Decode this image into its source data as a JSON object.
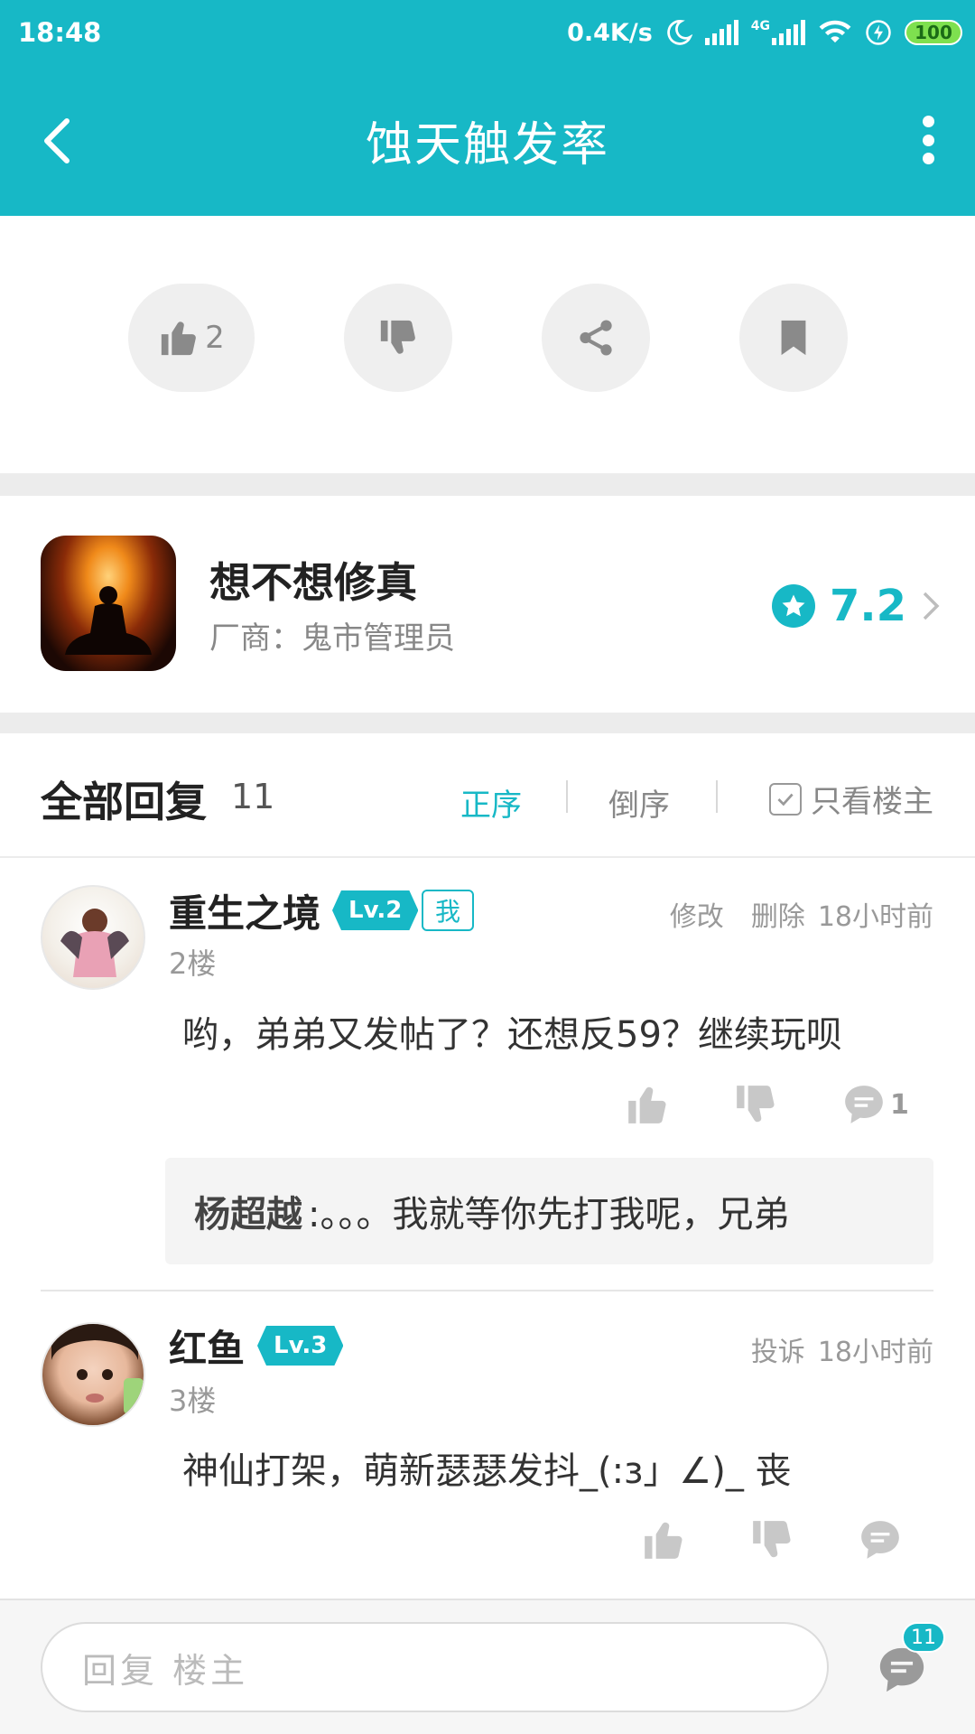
{
  "status_bar": {
    "time": "18:48",
    "net_speed": "0.4K/s",
    "network_type": "4G",
    "battery": "100",
    "icons": [
      "moon-icon",
      "signal-icon",
      "wifi-icon",
      "charging-icon"
    ]
  },
  "header": {
    "title": "蚀天触发率",
    "back_icon": "back-chevron-icon",
    "more_icon": "more-vertical-icon",
    "background": "#17b8c6"
  },
  "actions": {
    "like_count": "2",
    "items": [
      "like-icon",
      "dislike-icon",
      "share-icon",
      "bookmark-icon"
    ]
  },
  "game": {
    "name": "想不想修真",
    "vendor": "厂商：鬼市管理员",
    "rating": "7.2"
  },
  "replies": {
    "title": "全部回复",
    "count": "11",
    "sort_asc": "正序",
    "sort_desc": "倒序",
    "only_owner": "只看楼主",
    "accent": "#17b8c6"
  },
  "comments": [
    {
      "username": "重生之境",
      "level": "Lv.2",
      "me_badge": "我",
      "floor": "2楼",
      "actions": [
        "修改",
        "删除"
      ],
      "time": "18小时前",
      "text": "哟，弟弟又发帖了？还想反59？继续玩呗",
      "reply_count": "1",
      "subreply": {
        "author": "杨超越",
        "text": ":。。。我就等你先打我呢，兄弟"
      }
    },
    {
      "username": "红鱼",
      "level": "Lv.3",
      "floor": "3楼",
      "actions": [
        "投诉"
      ],
      "time": "18小时前",
      "text": "神仙打架，萌新瑟瑟发抖_(:з」∠)_ 丧"
    }
  ],
  "bottom": {
    "placeholder": "回复  楼主",
    "badge": "11"
  }
}
